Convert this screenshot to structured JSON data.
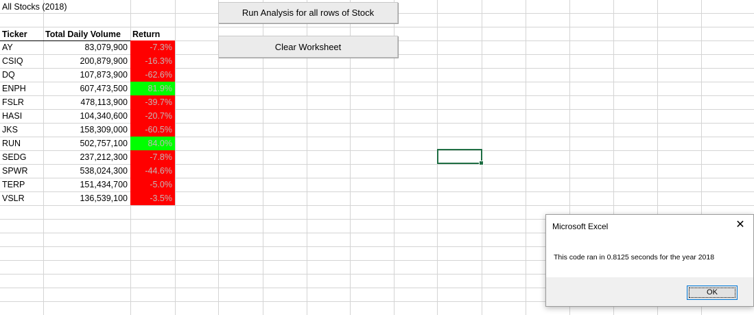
{
  "sheet": {
    "title": "All Stocks (2018)",
    "headers": {
      "ticker": "Ticker",
      "volume": "Total Daily Volume",
      "return": "Return"
    },
    "rows": [
      {
        "ticker": "AY",
        "volume": "83,079,900",
        "return": "-7.3%",
        "status": "negative"
      },
      {
        "ticker": "CSIQ",
        "volume": "200,879,900",
        "return": "-16.3%",
        "status": "negative"
      },
      {
        "ticker": "DQ",
        "volume": "107,873,900",
        "return": "-62.6%",
        "status": "negative"
      },
      {
        "ticker": "ENPH",
        "volume": "607,473,500",
        "return": "81.9%",
        "status": "positive"
      },
      {
        "ticker": "FSLR",
        "volume": "478,113,900",
        "return": "-39.7%",
        "status": "negative"
      },
      {
        "ticker": "HASI",
        "volume": "104,340,600",
        "return": "-20.7%",
        "status": "negative"
      },
      {
        "ticker": "JKS",
        "volume": "158,309,000",
        "return": "-60.5%",
        "status": "negative"
      },
      {
        "ticker": "RUN",
        "volume": "502,757,100",
        "return": "84.0%",
        "status": "positive"
      },
      {
        "ticker": "SEDG",
        "volume": "237,212,300",
        "return": "-7.8%",
        "status": "negative"
      },
      {
        "ticker": "SPWR",
        "volume": "538,024,300",
        "return": "-44.6%",
        "status": "negative"
      },
      {
        "ticker": "TERP",
        "volume": "151,434,700",
        "return": "-5.0%",
        "status": "negative"
      },
      {
        "ticker": "VSLR",
        "volume": "136,539,100",
        "return": "-3.5%",
        "status": "negative"
      }
    ]
  },
  "buttons": {
    "run_label": "Run Analysis for all rows of Stock",
    "clear_label": "Clear Worksheet"
  },
  "dialog": {
    "title": "Microsoft Excel",
    "close_icon": "close-icon",
    "message": "This code ran in 0.8125 seconds for the year 2018",
    "ok_label": "OK"
  },
  "colors": {
    "negative": "#ff0000",
    "positive": "#00ff00",
    "selection": "#1f6e43"
  }
}
